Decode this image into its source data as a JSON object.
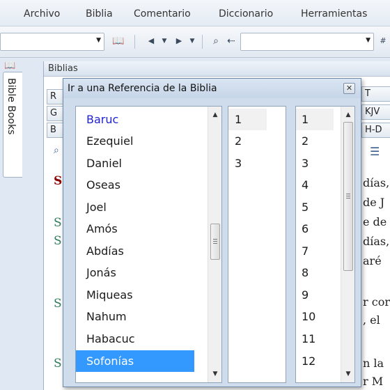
{
  "menubar": {
    "items": [
      "Archivo",
      "Biblia",
      "Comentario",
      "Diccionario",
      "Herramientas"
    ]
  },
  "toolbar": {
    "icons": [
      "book-icon",
      "back-icon",
      "forward-icon",
      "search-binoculars-icon",
      "search-next-icon"
    ]
  },
  "left_tabs": {
    "bible_books_label": "Bible Books"
  },
  "biblias_panel": {
    "title": "Biblias",
    "tab_fragments": [
      "R",
      "G",
      "B",
      "T",
      "KJV",
      "H-D"
    ],
    "background_text": [
      "días,",
      "de J",
      "e de",
      "días,",
      "aré",
      "r cor",
      ", el",
      "n la",
      "r M"
    ],
    "verse_marks": [
      "S",
      "S",
      "S",
      "S",
      "S"
    ]
  },
  "dialog": {
    "title": "Ir a una Referencia de la Biblia",
    "close_label": "✕",
    "books": [
      "Baruc",
      "Ezequiel",
      "Daniel",
      "Oseas",
      "Joel",
      "Amós",
      "Abdías",
      "Jonás",
      "Miqueas",
      "Nahum",
      "Habacuc",
      "Sofonías"
    ],
    "selected_book": "Sofonías",
    "highlighted_book": "Baruc",
    "chapters": [
      "1",
      "2",
      "3"
    ],
    "selected_chapter": "1",
    "verses": [
      "1",
      "2",
      "3",
      "4",
      "5",
      "6",
      "7",
      "8",
      "9",
      "10",
      "11",
      "12"
    ],
    "selected_verse": "1"
  },
  "colors": {
    "selection_blue": "#3399ff",
    "link_blue": "#1f1fd6",
    "verse_red": "#8b0000",
    "verse_green": "#2e7d5b"
  }
}
